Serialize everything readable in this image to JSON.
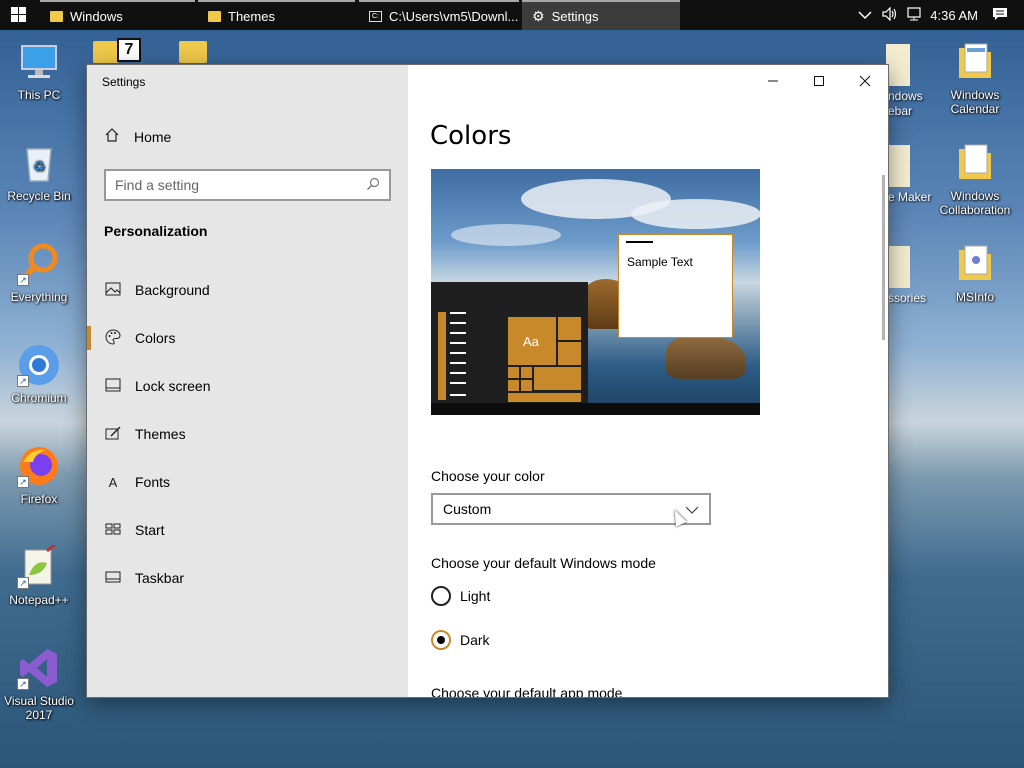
{
  "taskbar": {
    "apps": [
      {
        "label": "Windows",
        "icon": "folder-icon"
      },
      {
        "label": "Themes",
        "icon": "folder-icon"
      },
      {
        "label": "C:\\Users\\vm5\\Downl...",
        "icon": "command-prompt-icon"
      },
      {
        "label": "Settings",
        "icon": "gear-icon"
      }
    ],
    "clock": "4:36 AM"
  },
  "desktop": {
    "left_icons": [
      {
        "label": "This PC"
      },
      {
        "label": "Recycle Bin"
      },
      {
        "label": "Everything"
      },
      {
        "label": "Chromium"
      },
      {
        "label": "Firefox"
      },
      {
        "label": "Notepad++"
      },
      {
        "label": "Visual Studio 2017"
      }
    ],
    "right_icons": [
      {
        "label": "Windows Calendar"
      },
      {
        "label": "Windows Collaboration"
      },
      {
        "label": "MSInfo"
      }
    ],
    "partial_labels": [
      "ndows",
      "ebar",
      "e Maker",
      "ssories"
    ]
  },
  "settings": {
    "window_title": "Settings",
    "nav": {
      "home": "Home",
      "search_placeholder": "Find a setting",
      "section": "Personalization",
      "items": [
        {
          "label": "Background",
          "icon": "background-icon"
        },
        {
          "label": "Colors",
          "icon": "palette-icon",
          "selected": true
        },
        {
          "label": "Lock screen",
          "icon": "lock-screen-icon"
        },
        {
          "label": "Themes",
          "icon": "themes-icon"
        },
        {
          "label": "Fonts",
          "icon": "fonts-icon"
        },
        {
          "label": "Start",
          "icon": "start-icon"
        },
        {
          "label": "Taskbar",
          "icon": "taskbar-icon"
        }
      ]
    },
    "page": {
      "title": "Colors",
      "preview": {
        "sample_text": "Sample Text",
        "tile_text": "Aa"
      },
      "choose_color_label": "Choose your color",
      "choose_color_value": "Custom",
      "windows_mode_label": "Choose your default Windows mode",
      "windows_mode_options": [
        "Light",
        "Dark"
      ],
      "windows_mode_selected": "Dark",
      "app_mode_label": "Choose your default app mode"
    }
  },
  "colors": {
    "accent": "#c8892b",
    "nav_background": "#e6e6e6",
    "taskbar": "#101010"
  }
}
